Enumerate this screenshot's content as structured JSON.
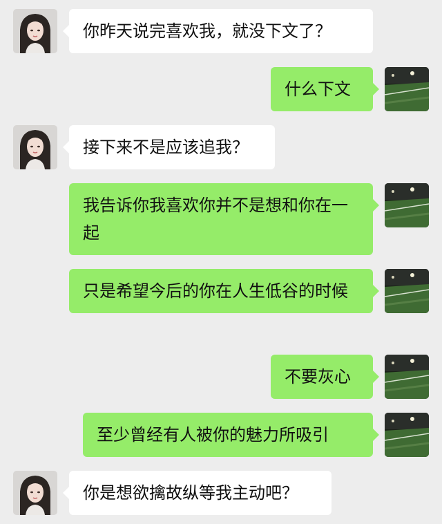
{
  "colors": {
    "background": "#ededed",
    "sent_bubble": "#95ec69",
    "received_bubble": "#ffffff"
  },
  "messages": [
    {
      "side": "left",
      "avatar": "girl-avatar",
      "text": "你昨天说完喜欢我，就没下文了？"
    },
    {
      "side": "right",
      "avatar": "soccer-field-avatar",
      "text": "什么下文"
    },
    {
      "side": "left",
      "avatar": "girl-avatar",
      "text": "接下来不是应该追我？"
    },
    {
      "side": "right",
      "avatar": "soccer-field-avatar",
      "text": "我告诉你我喜欢你并不是想和你在一起"
    },
    {
      "side": "right",
      "avatar": "soccer-field-avatar",
      "text": "只是希望今后的你在人生低谷的时候"
    },
    {
      "side": "right",
      "avatar": "soccer-field-avatar",
      "text": "不要灰心"
    },
    {
      "side": "right",
      "avatar": "soccer-field-avatar",
      "text": "至少曾经有人被你的魅力所吸引"
    },
    {
      "side": "left",
      "avatar": "girl-avatar",
      "text": "你是想欲擒故纵等我主动吧？"
    }
  ]
}
